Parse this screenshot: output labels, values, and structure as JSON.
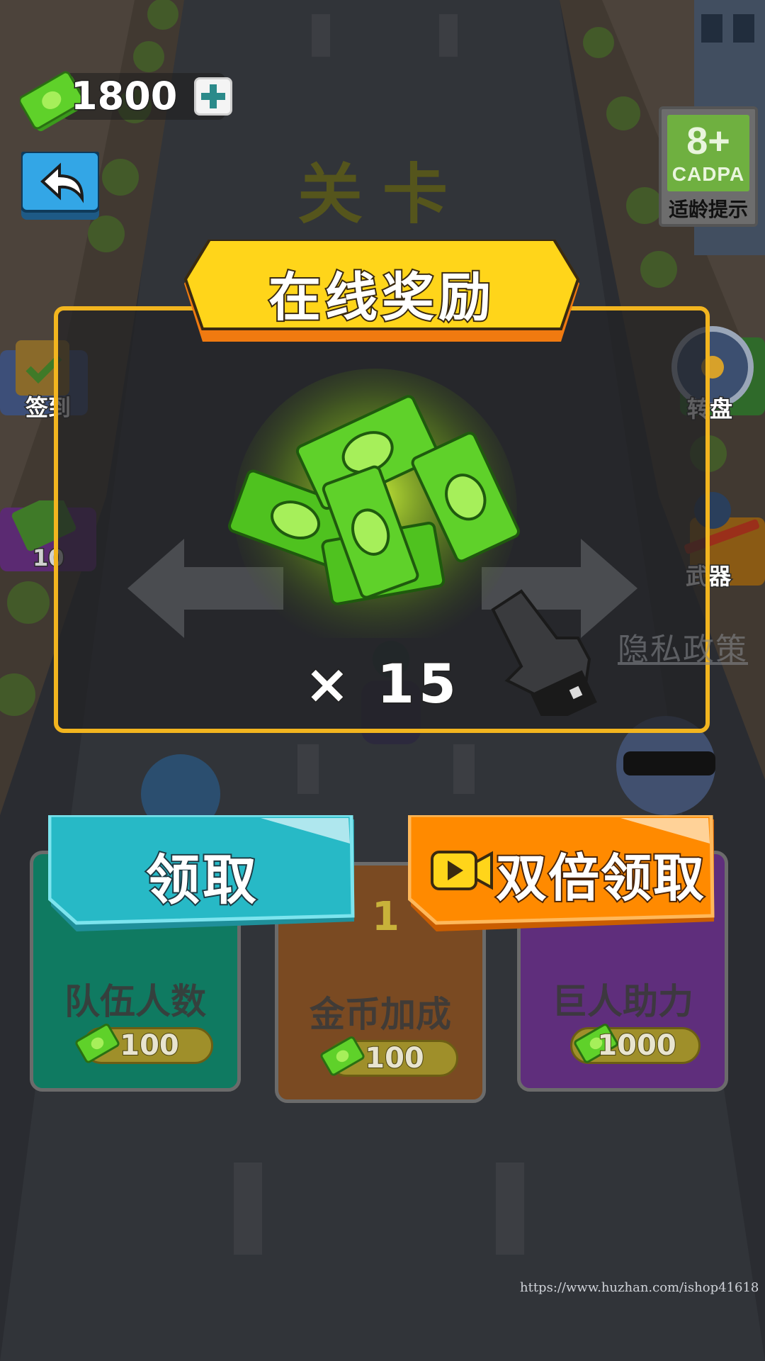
{
  "currency": {
    "amount": "1800",
    "icon": "cash-icon",
    "add_icon": "plus-icon"
  },
  "header": {
    "title": "关卡",
    "back_icon": "back-arrow-icon"
  },
  "age_rating": {
    "number": "8+",
    "label": "CADPA",
    "caption": "适龄提示"
  },
  "side_menu": {
    "left": [
      {
        "label": "签到",
        "icon": "check-in-icon"
      },
      {
        "label": "10",
        "icon": "cash-icon"
      }
    ],
    "right": [
      {
        "label": "转盘",
        "icon": "wheel-icon"
      },
      {
        "label": "武器",
        "icon": "weapon-icon"
      }
    ]
  },
  "privacy_link": "隐私政策",
  "reward_panel": {
    "title": "在线奖励",
    "quantity": "× 15",
    "reward_icon": "cash-stack-icon"
  },
  "actions": {
    "claim_label": "领取",
    "double_claim_label": "双倍领取",
    "video_icon": "video-play-icon"
  },
  "upgrades": [
    {
      "title": "队伍人数",
      "price": "100",
      "color": "#0f7a61"
    },
    {
      "title": "金币加成",
      "price": "100",
      "color": "#7a4a22",
      "badge": "1"
    },
    {
      "title": "巨人助力",
      "price": "1000",
      "color": "#5f2e7c"
    }
  ],
  "watermark": "https://www.huzhan.com/ishop41618",
  "colors": {
    "panel_border": "#f2b51f",
    "banner_yellow": "#ffd51a",
    "claim_cyan": "#27b9c6",
    "double_orange": "#ff8a00"
  }
}
